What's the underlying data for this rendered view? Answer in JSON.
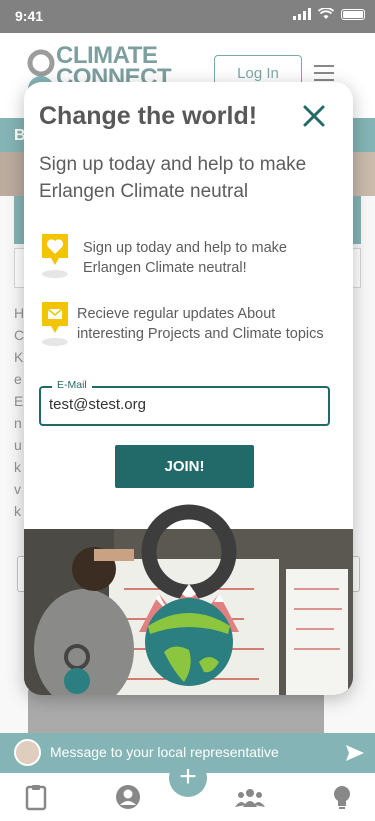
{
  "status_bar": {
    "time": "9:41"
  },
  "header": {
    "logo_line1": "CLIMATE",
    "logo_line2": "CONNECT",
    "login_label": "Log In",
    "menu_icon": "hamburger-icon"
  },
  "background": {
    "band_letter": "B",
    "text_lines": [
      "H",
      "C",
      "K",
      "e",
      "E",
      "n",
      "u",
      "k",
      "v",
      "k"
    ]
  },
  "modal": {
    "title": "Change the world!",
    "subtitle": "Sign up today and help to make Erlangen Climate neutral",
    "features": [
      {
        "icon": "heart-icon",
        "text": "Sign up today and help to make Erlangen Climate neutral!"
      },
      {
        "icon": "envelope-icon",
        "text": "Recieve regular updates About interesting Projects and Climate topics"
      }
    ],
    "email_label": "E-Mail",
    "email_value": "test@stest.org",
    "join_label": "JOIN!"
  },
  "message_bar": {
    "placeholder": "Message to your local representative"
  },
  "tab_bar": {
    "tabs": [
      "clipboard-icon",
      "profile-icon",
      "plus-icon",
      "people-icon",
      "lightbulb-icon"
    ]
  },
  "colors": {
    "teal_dark": "#226a69",
    "teal": "#2b7f80",
    "accent_yellow": "#f2c500"
  }
}
